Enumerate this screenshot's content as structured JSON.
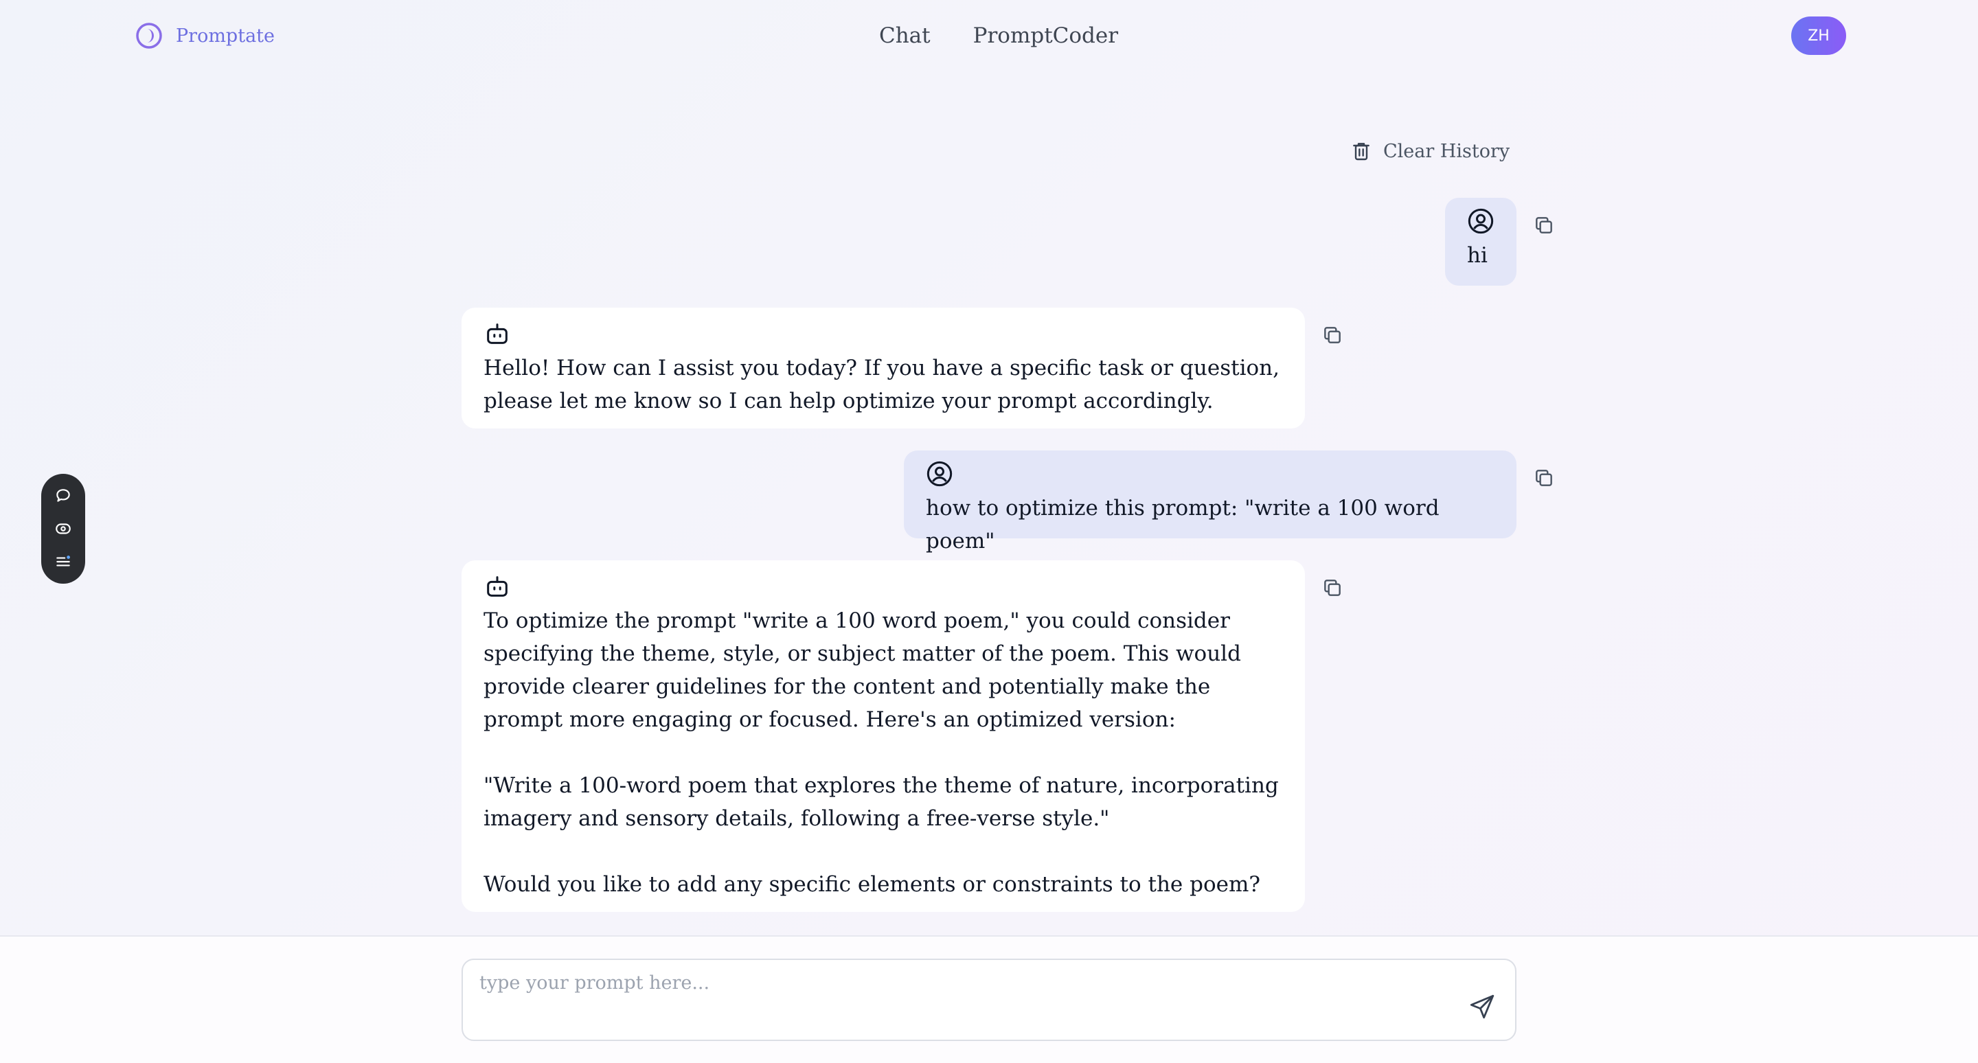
{
  "header": {
    "brand_name": "Promptate",
    "nav": [
      "Chat",
      "PromptCoder"
    ],
    "avatar_initials": "ZH"
  },
  "chat": {
    "clear_history_label": "Clear History",
    "messages": [
      {
        "role": "user",
        "text": "hi"
      },
      {
        "role": "assistant",
        "text": "Hello! How can I assist you today? If you have a specific task or question, please let me know so I can help optimize your prompt accordingly."
      },
      {
        "role": "user",
        "text": "how to optimize this prompt: \"write a 100 word poem\""
      },
      {
        "role": "assistant",
        "text": "To optimize the prompt \"write a 100 word poem,\" you could consider specifying the theme, style, or subject matter of the poem. This would provide clearer guidelines for the content and potentially make the prompt more engaging or focused. Here's an optimized version:\n\n\"Write a 100-word poem that explores the theme of nature, incorporating imagery and sensory details, following a free-verse style.\"\n\nWould you like to add any specific elements or constraints to the poem?"
      }
    ]
  },
  "input": {
    "placeholder": "type your prompt here..."
  },
  "colors": {
    "accent": "#6d6fe0",
    "user_bubble": "#e3e6f8",
    "assistant_bubble": "#ffffff",
    "toolbar": "#2b2d31"
  },
  "icons": [
    "brand-logo-icon",
    "trash-icon",
    "user-icon",
    "bot-icon",
    "copy-icon",
    "chat-bubble-icon",
    "eye-icon",
    "list-icon",
    "send-icon"
  ]
}
